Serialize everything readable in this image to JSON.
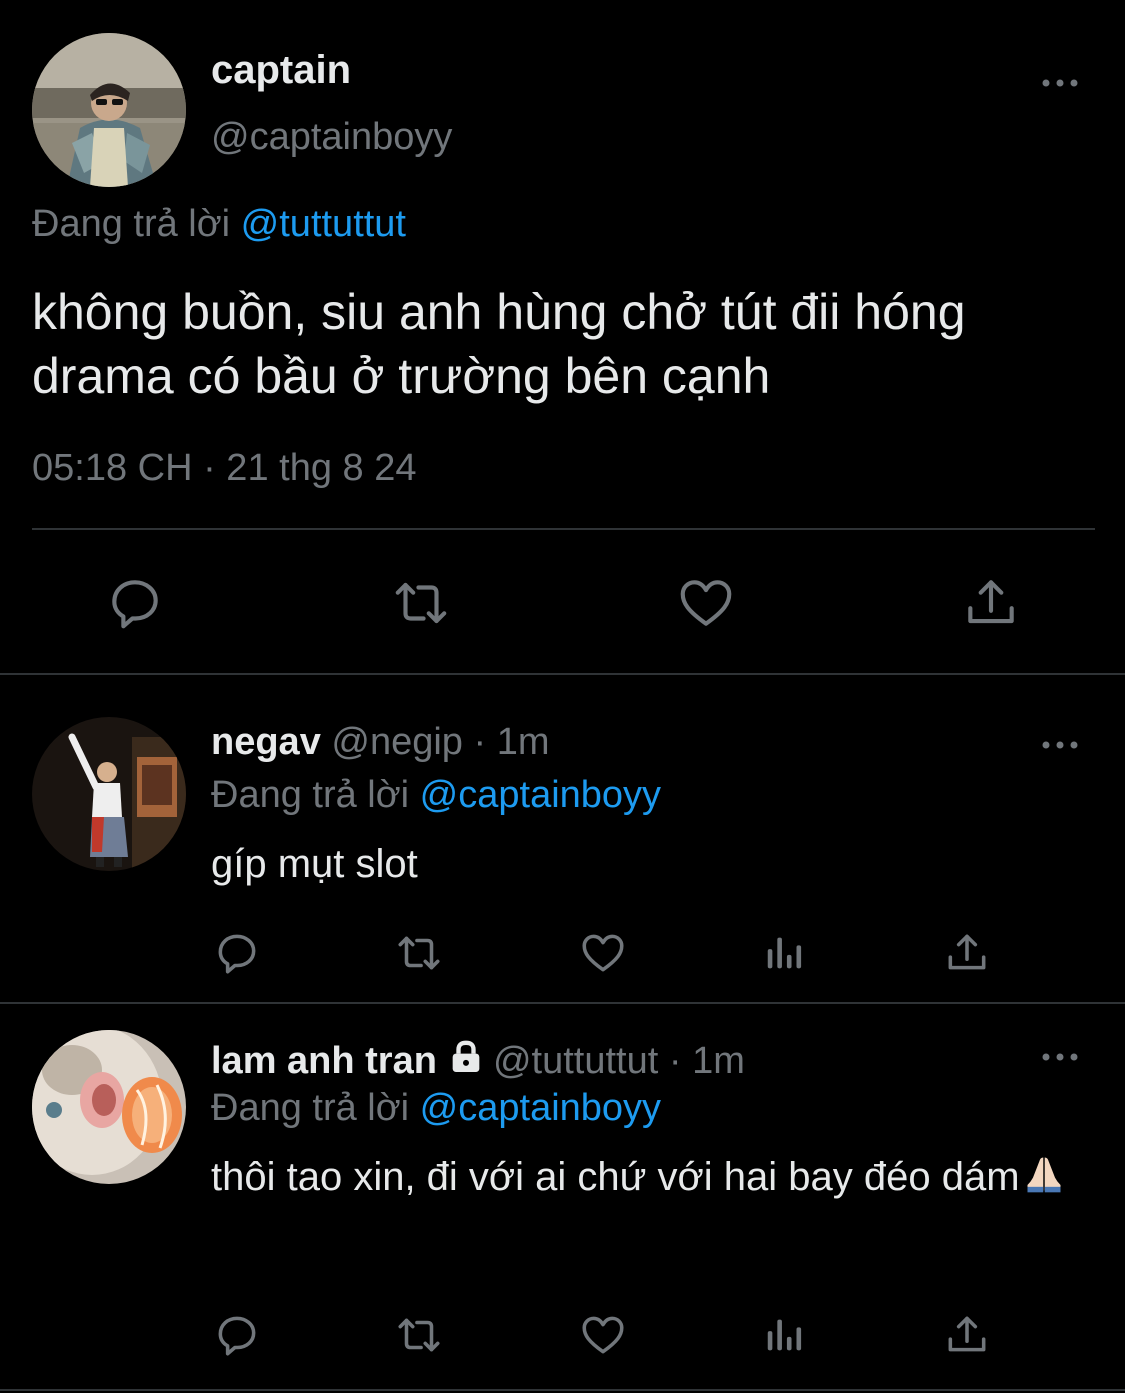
{
  "main": {
    "author": {
      "name": "captain",
      "handle": "@captainboyy",
      "avatar_icon": "profile-photo"
    },
    "reply_prefix": "Đang trả lời",
    "reply_to": "@tuttuttut",
    "text": "không buồn, siu anh hùng chở tút đii hóng drama có bầu ở trường bên cạnh",
    "timestamp": "05:18 CH · 21 thg 8 24",
    "actions": [
      "reply-icon",
      "retweet-icon",
      "like-icon",
      "share-icon"
    ]
  },
  "replies": [
    {
      "name": "negav",
      "handle": "@negip",
      "dot": "·",
      "time": "1m",
      "reply_prefix": "Đang trả lời",
      "reply_to": "@captainboyy",
      "text": "gíp mụt slot",
      "actions": [
        "reply-icon",
        "retweet-icon",
        "like-icon",
        "views-icon",
        "share-icon"
      ]
    },
    {
      "name": "lam anh tran",
      "handle": "@tuttuttut",
      "dot": "·",
      "time": "1m",
      "protected_icon": "lock-icon",
      "reply_prefix": "Đang trả lời",
      "reply_to": "@captainboyy",
      "text": "thôi tao xin, đi với ai chứ với hai bay đéo dám",
      "emoji_icon": "folded-hands-emoji",
      "actions": [
        "reply-icon",
        "retweet-icon",
        "like-icon",
        "views-icon",
        "share-icon"
      ]
    }
  ],
  "colors": {
    "background": "#000000",
    "text": "#e7e9ea",
    "secondary": "#71767b",
    "link": "#1d9bf0",
    "divider": "#2f3336"
  }
}
